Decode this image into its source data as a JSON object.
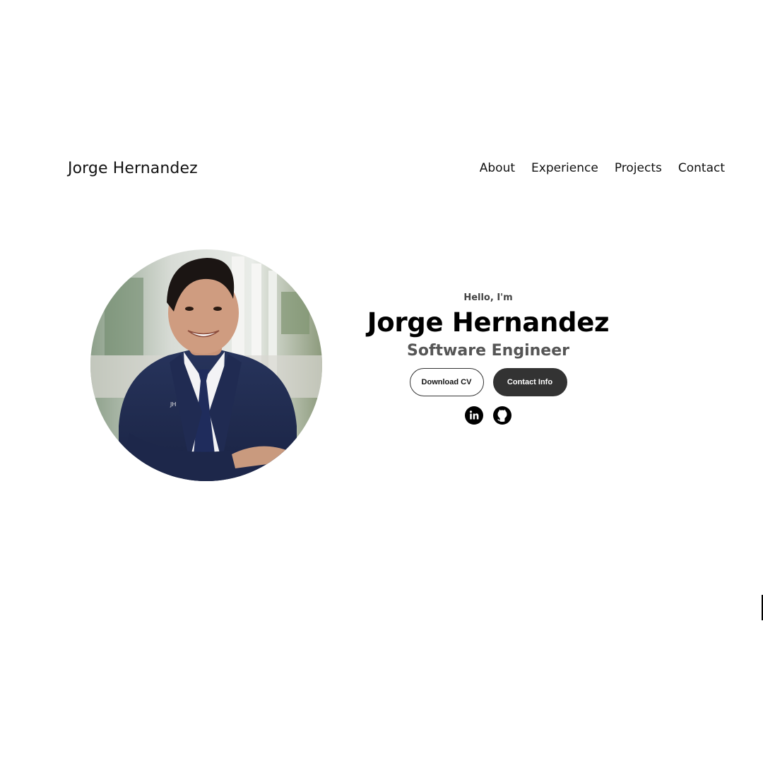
{
  "header": {
    "logo": "Jorge Hernandez",
    "nav": [
      "About",
      "Experience",
      "Projects",
      "Contact"
    ]
  },
  "hero": {
    "greeting": "Hello, I'm",
    "name": "Jorge Hernandez",
    "role": "Software Engineer",
    "primary_button": "Download CV",
    "secondary_button": "Contact Info",
    "socials": [
      "linkedin-icon",
      "github-icon"
    ],
    "photo": "profile-photo"
  },
  "colors": {
    "text": "#000000",
    "role": "#555555",
    "button_dark": "#333333",
    "background": "#ffffff",
    "suit": "#1f2a4d"
  }
}
